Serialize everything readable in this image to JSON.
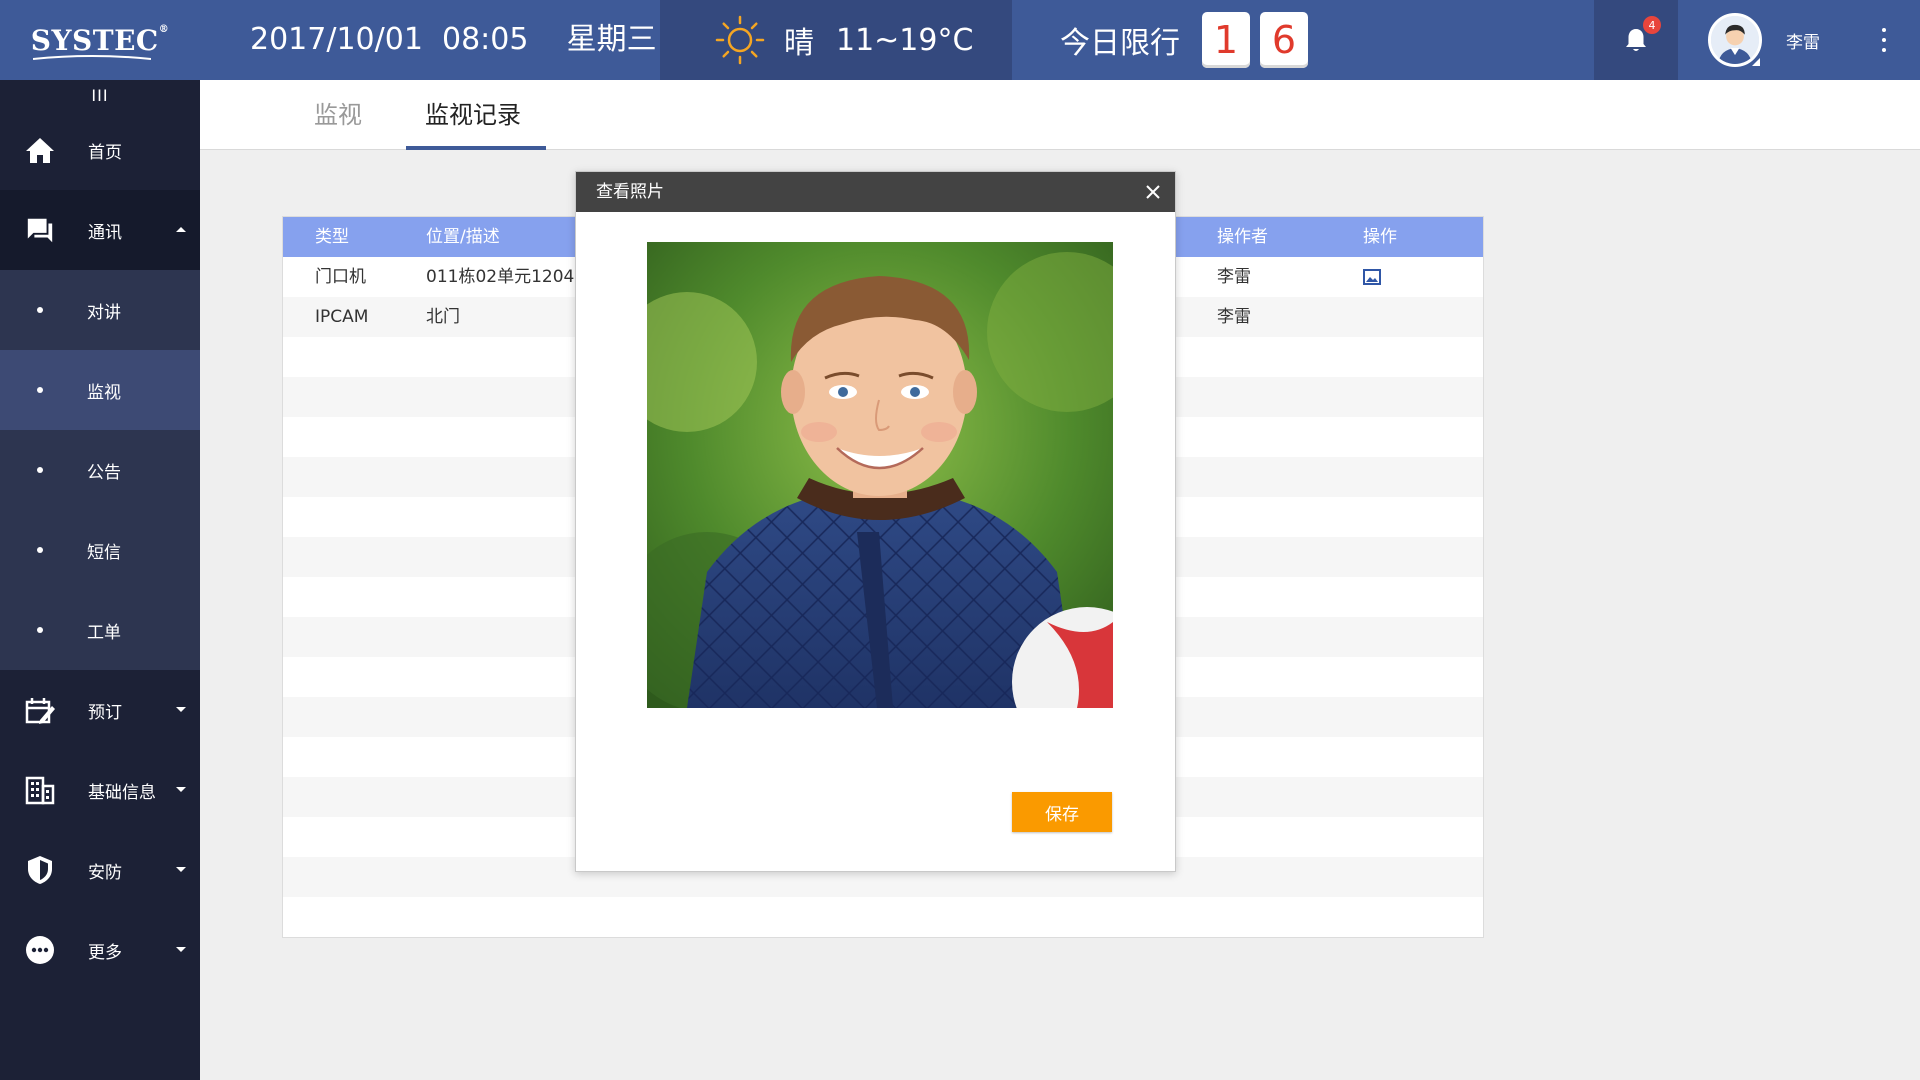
{
  "header": {
    "logo": "SYSTEC",
    "logo_mark": "®",
    "date": "2017/10/01",
    "time": "08:05",
    "weekday": "星期三",
    "weather_condition": "晴",
    "temperature": "11~19°C",
    "limit_label": "今日限行",
    "limit_digits": [
      "1",
      "6"
    ],
    "notification_count": "4",
    "username": "李雷"
  },
  "sidebar": {
    "collapse_label": "III",
    "items": [
      {
        "label": "首页",
        "icon": "home-icon"
      },
      {
        "label": "通讯",
        "icon": "chat-icon",
        "expanded": true
      },
      {
        "label": "预订",
        "icon": "booking-icon"
      },
      {
        "label": "基础信息",
        "icon": "building-icon"
      },
      {
        "label": "安防",
        "icon": "shield-icon"
      },
      {
        "label": "更多",
        "icon": "more-icon"
      }
    ],
    "sub_items": [
      "对讲",
      "监视",
      "公告",
      "短信",
      "工单"
    ],
    "active_sub_item": "监视"
  },
  "tabs": [
    {
      "label": "监视",
      "active": false
    },
    {
      "label": "监视记录",
      "active": true
    }
  ],
  "table": {
    "columns": [
      "类型",
      "位置/描述",
      "操作者",
      "操作"
    ],
    "rows": [
      {
        "type": "门口机",
        "location": "011栋02单元1204",
        "operator": "李雷",
        "has_image_action": true
      },
      {
        "type": "IPCAM",
        "location": "北门",
        "operator": "李雷",
        "has_image_action": false
      }
    ]
  },
  "modal": {
    "title": "查看照片",
    "save_label": "保存"
  },
  "colors": {
    "header_bg": "#3e5a98",
    "header_dark": "#34497e",
    "sidebar_bg": "#1c2136",
    "table_header": "#86a1ee",
    "accent_orange": "#fa9a00",
    "plate_red": "#e03a2c"
  }
}
